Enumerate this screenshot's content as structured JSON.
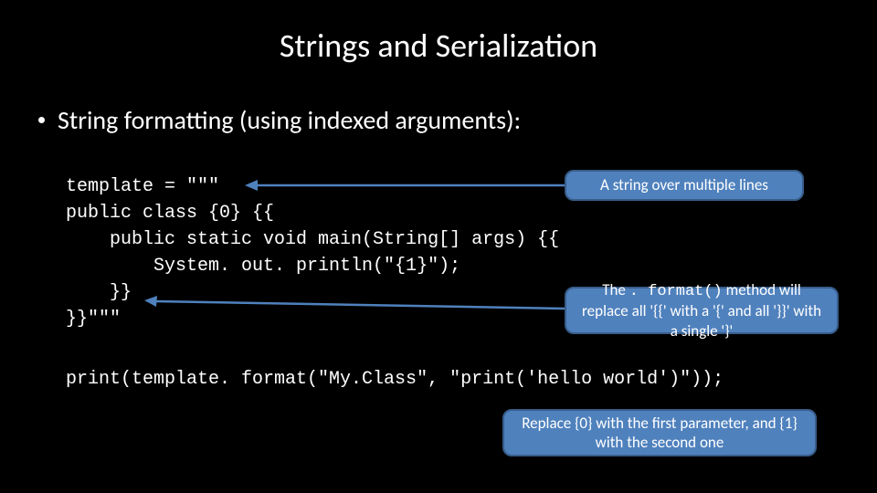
{
  "title": "Strings and Serialization",
  "bullet": "String formatting (using indexed arguments):",
  "code": {
    "l1": "template = \"\"\"",
    "l2": "public class {0} {{",
    "l3": "    public static void main(String[] args) {{",
    "l4": "        System. out. println(\"{1}\");",
    "l5": "    }}",
    "l6": "}}\"\"\""
  },
  "print_line": "print(template. format(\"My.Class\", \"print('hello world')\"));",
  "callouts": {
    "c1": "A string over multiple lines",
    "c2_a": "The ",
    "c2_mono": ". format()",
    "c2_b": " method will replace all '{{' with a '{' and all '}}' with a single '}'",
    "c3": "Replace {0} with the first parameter, and {1} with the second one"
  }
}
